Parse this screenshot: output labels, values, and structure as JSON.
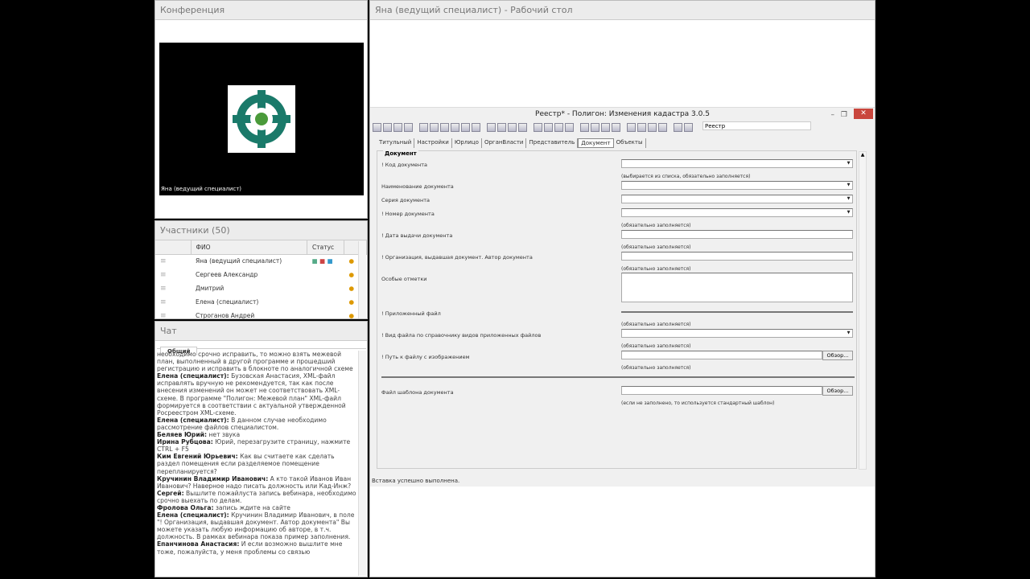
{
  "conference": {
    "title": "Конференция",
    "video_name": "Яна (ведущий специалист)"
  },
  "participants": {
    "title": "Участники (50)",
    "col_name": "ФИО",
    "col_status": "Статус",
    "rows": [
      "Яна (ведущий специалист)",
      "Сергеев Александр",
      "Дмитрий",
      "Елена (специалист)",
      "Строганов Андрей"
    ]
  },
  "chat": {
    "title": "Чат",
    "tab": "Общий",
    "messages": [
      {
        "author": "",
        "text": "необходимо срочно исправить, то можно взять межевой план, выполненный в другой программе и прошедший регистрацию и исправить в блокноте по аналогичной схеме"
      },
      {
        "author": "Елена (специалист):",
        "text": " Бузовская Анастасия, XML-файл исправлять вручную не рекомендуется, так как после внесения изменений он может не соответствовать XML-схеме. В программе \"Полигон: Межевой план\" XML-файл формируется в соответствии с актуальной утвержденной Росреестром XML-схеме."
      },
      {
        "author": "Елена (специалист):",
        "text": " В данном случае необходимо рассмотрение файлов специалистом."
      },
      {
        "author": "Беляев Юрий:",
        "text": " нет звука"
      },
      {
        "author": "Ирина Рубцова:",
        "text": " Юрий, перезагрузите страницу, нажмите CTRL + F5"
      },
      {
        "author": "Ким Евгений  Юрьевич:",
        "text": " Как вы считаете как сделать раздел помещения если разделяемое помещение перепланируется?"
      },
      {
        "author": "Кручинин Владимир  Иванович:",
        "text": " А кто такой Иванов Иван Иванович? Наверное надо писать должность или Кад-Инж?"
      },
      {
        "author": "Сергей:",
        "text": " Вышлите пожайлуста запись вебинара, необходимо срочно выехать по делам."
      },
      {
        "author": "Фролова Ольга:",
        "text": " запись ждите на сайте"
      },
      {
        "author": "Елена (специалист):",
        "text": " Кручинин Владимир  Иванович, в поле \"! Организация, выдавшая документ. Автор документа\" Вы можете указать любую информацию об авторе, в т.ч. должность. В рамках вебинара показа пример заполнения."
      },
      {
        "author": "Епанчинова Анастасия:",
        "text": " И если возможно вышлите мне тоже, пожалуйста, у меня проблемы со связью"
      }
    ]
  },
  "desktop": {
    "title": "Яна (ведущий специалист) - Рабочий стол"
  },
  "app": {
    "title": "Реестр* - Полигон: Изменения кадастра 3.0.5",
    "search_value": "Реестр",
    "tabs": [
      "Титульный",
      "Настройки",
      "Юрлицо",
      "ОрганВласти",
      "Представитель",
      "Документ",
      "Объекты"
    ],
    "active_tab": "Документ",
    "group": "Документ",
    "browse": "Обзор...",
    "fields": [
      {
        "label": "! Код документа",
        "type": "combo",
        "hint": "(выбирается из списка, обязательно заполняется)"
      },
      {
        "label": "Наименование документа",
        "type": "combo",
        "hint": ""
      },
      {
        "label": "Серия документа",
        "type": "combo",
        "hint": ""
      },
      {
        "label": "! Номер документа",
        "type": "combo",
        "hint": "(обязательно заполняется)"
      },
      {
        "label": "! Дата выдачи документа",
        "type": "text",
        "hint": "(обязательно заполняется)"
      },
      {
        "label": "! Организация, выдавшая документ. Автор документа",
        "type": "text",
        "hint": "(обязательно заполняется)"
      },
      {
        "label": "Особые отметки",
        "type": "area",
        "hint": ""
      },
      {
        "label": "! Приложенный файл",
        "type": "line",
        "hint": "(обязательно заполняется)"
      },
      {
        "label": "! Вид файла по справочнику видов приложенных файлов",
        "type": "combo",
        "hint": "(обязательно заполняется)"
      },
      {
        "label": "! Путь к файлу с изображением",
        "type": "browse",
        "hint": "(обязательно заполняется)"
      },
      {
        "label": "Файл шаблона документа",
        "type": "browse",
        "hint": "(если не заполнено, то используется стандартный шаблон)"
      }
    ],
    "status": "Вставка успешно выполнена."
  }
}
